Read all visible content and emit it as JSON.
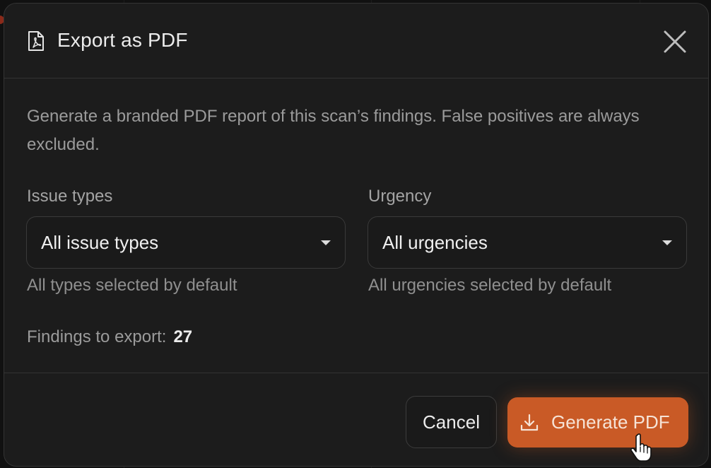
{
  "dialog": {
    "title": "Export as PDF",
    "icon": "pdf-file-icon",
    "close_icon": "close-icon",
    "description": "Generate a branded PDF report of this scan’s findings. False positives are always excluded."
  },
  "filters": {
    "issue_types": {
      "label": "Issue types",
      "value": "All issue types",
      "helper": "All types selected by default"
    },
    "urgency": {
      "label": "Urgency",
      "value": "All urgencies",
      "helper": "All urgencies selected by default"
    }
  },
  "summary": {
    "label": "Findings to export:",
    "count": "27"
  },
  "footer": {
    "cancel_label": "Cancel",
    "generate_label": "Generate PDF",
    "generate_icon": "download-icon"
  },
  "colors": {
    "accent": "#c95a26",
    "dialog_bg": "#1c1c1c",
    "text_primary": "#ececec",
    "text_muted": "#9b9b9b"
  }
}
